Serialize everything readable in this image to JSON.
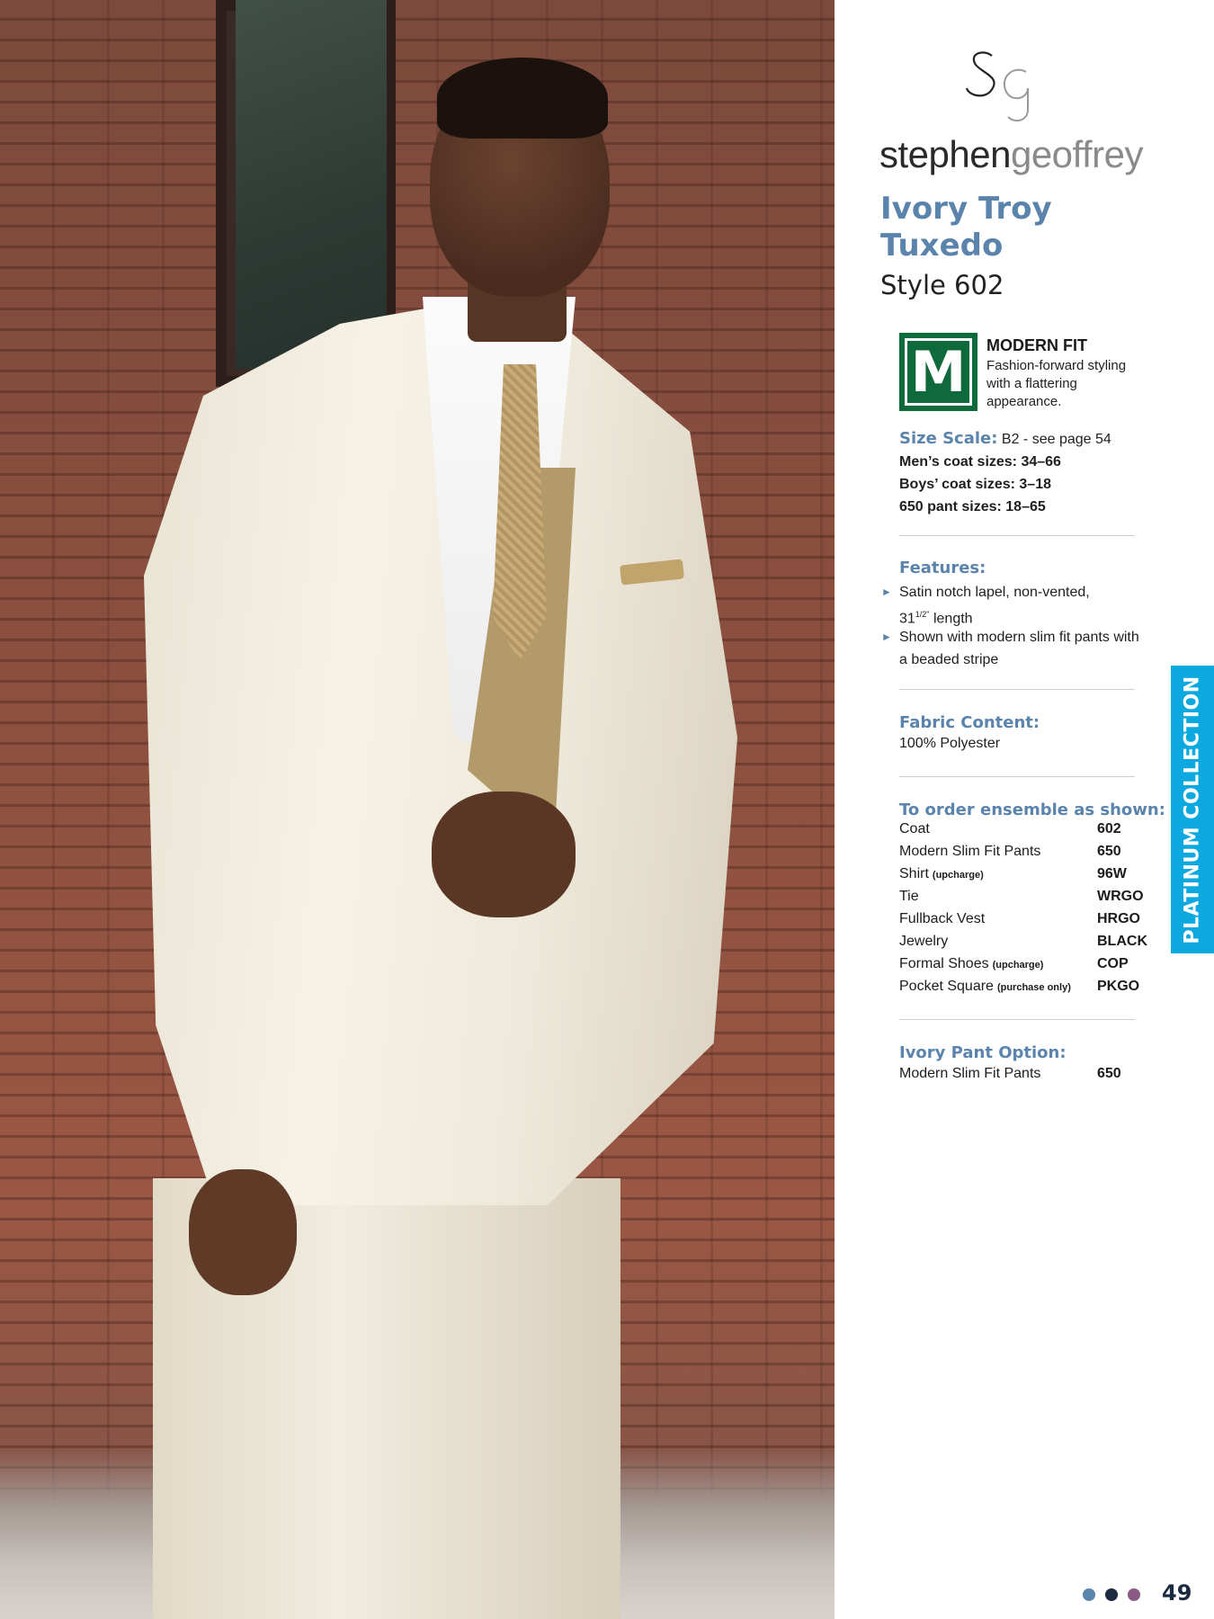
{
  "brand": {
    "name_part1": "stephen",
    "name_part2": "geoffrey",
    "monogram": "SG"
  },
  "product": {
    "title": "Ivory Troy Tuxedo",
    "style": "Style 602"
  },
  "fit": {
    "badge_letter": "M",
    "title": "MODERN FIT",
    "description": "Fashion-forward styling with a flattering appearance."
  },
  "size": {
    "label": "Size Scale:",
    "scale": "B2 - see page 54",
    "mens": "Men’s coat sizes: 34–66",
    "boys": "Boys’ coat sizes: 3–18",
    "pants": "650 pant sizes: 18–65"
  },
  "features": {
    "heading": "Features:",
    "item1_line1": "Satin notch lapel, non-vented,",
    "item1_num": "31",
    "item1_frac": "1/2\"",
    "item1_tail": " length",
    "item2": "Shown with modern slim fit pants with a beaded stripe"
  },
  "fabric": {
    "heading": "Fabric Content:",
    "value": "100% Polyester"
  },
  "order": {
    "heading": "To order ensemble as shown:",
    "rows": [
      {
        "item": "Coat",
        "note": "",
        "code": "602"
      },
      {
        "item": "Modern Slim Fit Pants",
        "note": "",
        "code": "650"
      },
      {
        "item": "Shirt",
        "note": "(upcharge)",
        "code": "96W"
      },
      {
        "item": "Tie",
        "note": "",
        "code": "WRGO"
      },
      {
        "item": "Fullback Vest",
        "note": "",
        "code": "HRGO"
      },
      {
        "item": "Jewelry",
        "note": "",
        "code": "BLACK"
      },
      {
        "item": "Formal Shoes",
        "note": "(upcharge)",
        "code": "COP"
      },
      {
        "item": "Pocket Square",
        "note": "(purchase only)",
        "code": "PKGO"
      }
    ]
  },
  "pant_option": {
    "heading": "Ivory Pant Option:",
    "item": "Modern Slim Fit Pants",
    "code": "650"
  },
  "collection_tab": "PLATINUM COLLECTION",
  "page_number": "49",
  "colors": {
    "accent_blue": "#5b84ad",
    "badge_green": "#0f6a3b",
    "tab_cyan": "#0ca8e0",
    "dot1": "#5b84ad",
    "dot2": "#1a2a40",
    "dot3": "#8a5a86"
  }
}
